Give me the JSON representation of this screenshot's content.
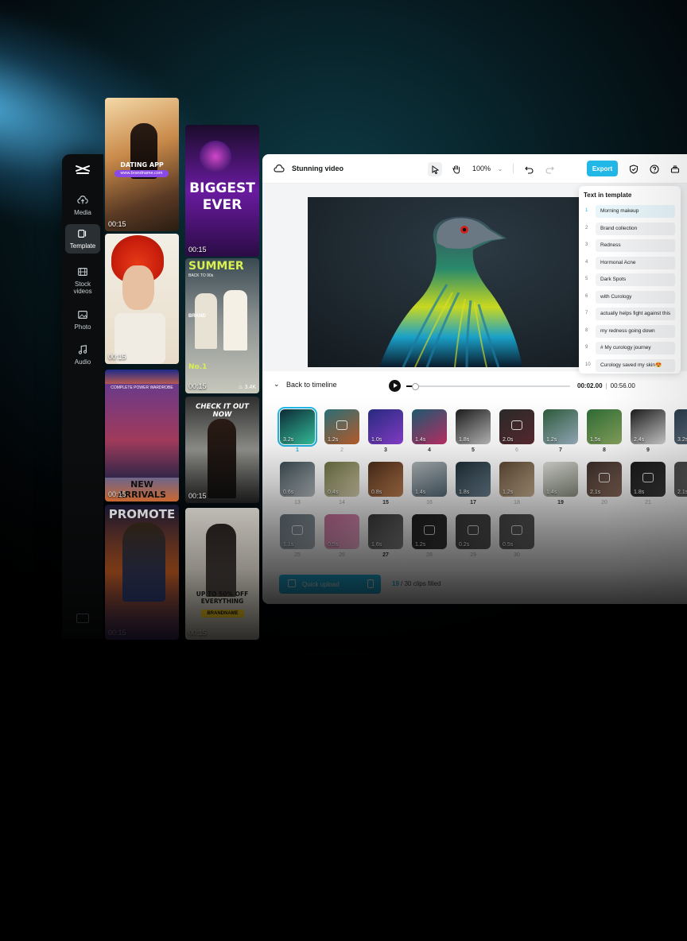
{
  "sidebar": {
    "logo_icon": "capcut-logo-icon",
    "items": [
      {
        "label": "Media",
        "icon": "cloud-upload-icon"
      },
      {
        "label": "Template",
        "icon": "template-icon",
        "active": true
      },
      {
        "label": "Stock videos",
        "icon": "film-icon"
      },
      {
        "label": "Photo",
        "icon": "image-icon"
      },
      {
        "label": "Audio",
        "icon": "music-note-icon"
      }
    ]
  },
  "templates": {
    "col1": [
      {
        "duration": "00:15",
        "title": "DATING APP",
        "sub": "www.brandname.com"
      },
      {
        "duration": "00:15"
      },
      {
        "duration": "00:15",
        "title": "NEW ARRIVALS",
        "sub": "COMPLETE POWER WARDROBE"
      },
      {
        "duration": "00:15",
        "title": "PROMOTE"
      }
    ],
    "col2": [
      {
        "duration": "00:15",
        "title": "BIGGEST EVER"
      },
      {
        "duration": "00:15",
        "title": "SUMMER",
        "badge": "No.1",
        "sub": "BACK TO 90s",
        "brand": "BRAND",
        "likes": "3.4K"
      },
      {
        "duration": "00:15",
        "title": "CHECK IT OUT NOW"
      },
      {
        "duration": "00:15",
        "title": "UP TO 50% OFF EVERYTHING",
        "brand": "BRANDNAME"
      }
    ]
  },
  "editor": {
    "project_name": "Stunning video",
    "zoom": "100%",
    "export_label": "Export",
    "text_in_template": {
      "header": "Text in template",
      "items": [
        "Morning makeup",
        "Brand collection",
        "Redness",
        "Hormonal Acne",
        "Dark Spots",
        "with Curology",
        "actually helps fight against this",
        "my redness going down",
        "# My curology journey",
        "Curology saved my skin😍"
      ]
    },
    "timeline": {
      "back_label": "Back to timeline",
      "current_time": "00:02.00",
      "total_time": "00:56.00",
      "progress": 0.05
    },
    "clips": [
      {
        "n": "1",
        "d": "3.2s",
        "c": [
          "#0c2a36",
          "#36c6a0"
        ],
        "sel": true
      },
      {
        "n": "2",
        "d": "1.2s",
        "c": [
          "#2a6f78",
          "#c0602c"
        ],
        "ph": true
      },
      {
        "n": "3",
        "d": "1.0s",
        "c": [
          "#262a80",
          "#8a3fd0"
        ]
      },
      {
        "n": "4",
        "d": "1.4s",
        "c": [
          "#1c5a70",
          "#c0306a"
        ]
      },
      {
        "n": "5",
        "d": "1.8s",
        "c": [
          "#1b1b1b",
          "#bcbcbc"
        ]
      },
      {
        "n": "6",
        "d": "2.0s",
        "c": [
          "#2a2a2a",
          "#5a2a30"
        ],
        "ph": true
      },
      {
        "n": "7",
        "d": "1.2s",
        "c": [
          "#2c5a3a",
          "#9ab0c0"
        ]
      },
      {
        "n": "8",
        "d": "1.5s",
        "c": [
          "#2e6a34",
          "#8aa860"
        ]
      },
      {
        "n": "9",
        "d": "2.4s",
        "c": [
          "#1a1a1a",
          "#d8d8d8"
        ]
      },
      {
        "n": "",
        "d": "3.2s",
        "c": [
          "#2a3a4a",
          "#6a7a8a"
        ]
      },
      {
        "n": "13",
        "d": "0.6s",
        "c": [
          "#3a4a52",
          "#b8c0c4"
        ]
      },
      {
        "n": "14",
        "d": "0.4s",
        "c": [
          "#6a7040",
          "#d8d0b0"
        ]
      },
      {
        "n": "15",
        "d": "0.8s",
        "c": [
          "#4a2a18",
          "#c08050"
        ]
      },
      {
        "n": "16",
        "d": "1.4s",
        "c": [
          "#b0b6b8",
          "#556a78"
        ]
      },
      {
        "n": "17",
        "d": "1.8s",
        "c": [
          "#1c2c34",
          "#6a8090"
        ]
      },
      {
        "n": "18",
        "d": "1.2s",
        "c": [
          "#5a4632",
          "#c8b090"
        ]
      },
      {
        "n": "19",
        "d": "1.4s",
        "c": [
          "#dfe0da",
          "#8a9080"
        ]
      },
      {
        "n": "20",
        "d": "2.1s",
        "c": [
          "#3a2e2a",
          "#8a6a5a"
        ],
        "ph": true
      },
      {
        "n": "21",
        "d": "1.8s",
        "c": [
          "#1a1a1a",
          "#3a3a3a"
        ],
        "ph": true
      },
      {
        "n": "",
        "d": "2.1s",
        "c": [
          "#4a4a4a",
          "#6a6a6a"
        ]
      },
      {
        "n": "25",
        "d": "1.1s",
        "c": [
          "#6a7a84",
          "#aab4ba"
        ],
        "ph": true
      },
      {
        "n": "26",
        "d": "0.5s",
        "c": [
          "#d070a0",
          "#f4b4d4"
        ]
      },
      {
        "n": "27",
        "d": "1.6s",
        "c": [
          "#3a3a3a",
          "#8a8a8a"
        ]
      },
      {
        "n": "28",
        "d": "1.2s",
        "c": [
          "#202020",
          "#3a3a3a"
        ],
        "ph": true
      },
      {
        "n": "29",
        "d": "0.2s",
        "c": [
          "#3a3a3a",
          "#5a5a5a"
        ],
        "ph": true
      },
      {
        "n": "30",
        "d": "0.5s",
        "c": [
          "#4a4a4a",
          "#6a6a6a"
        ],
        "ph": true
      }
    ],
    "quick_upload_label": "Quick upload",
    "clips_filled_current": "19",
    "clips_filled_rest": "/ 30 clips filled"
  },
  "colors": {
    "accent": "#21b8e8"
  }
}
